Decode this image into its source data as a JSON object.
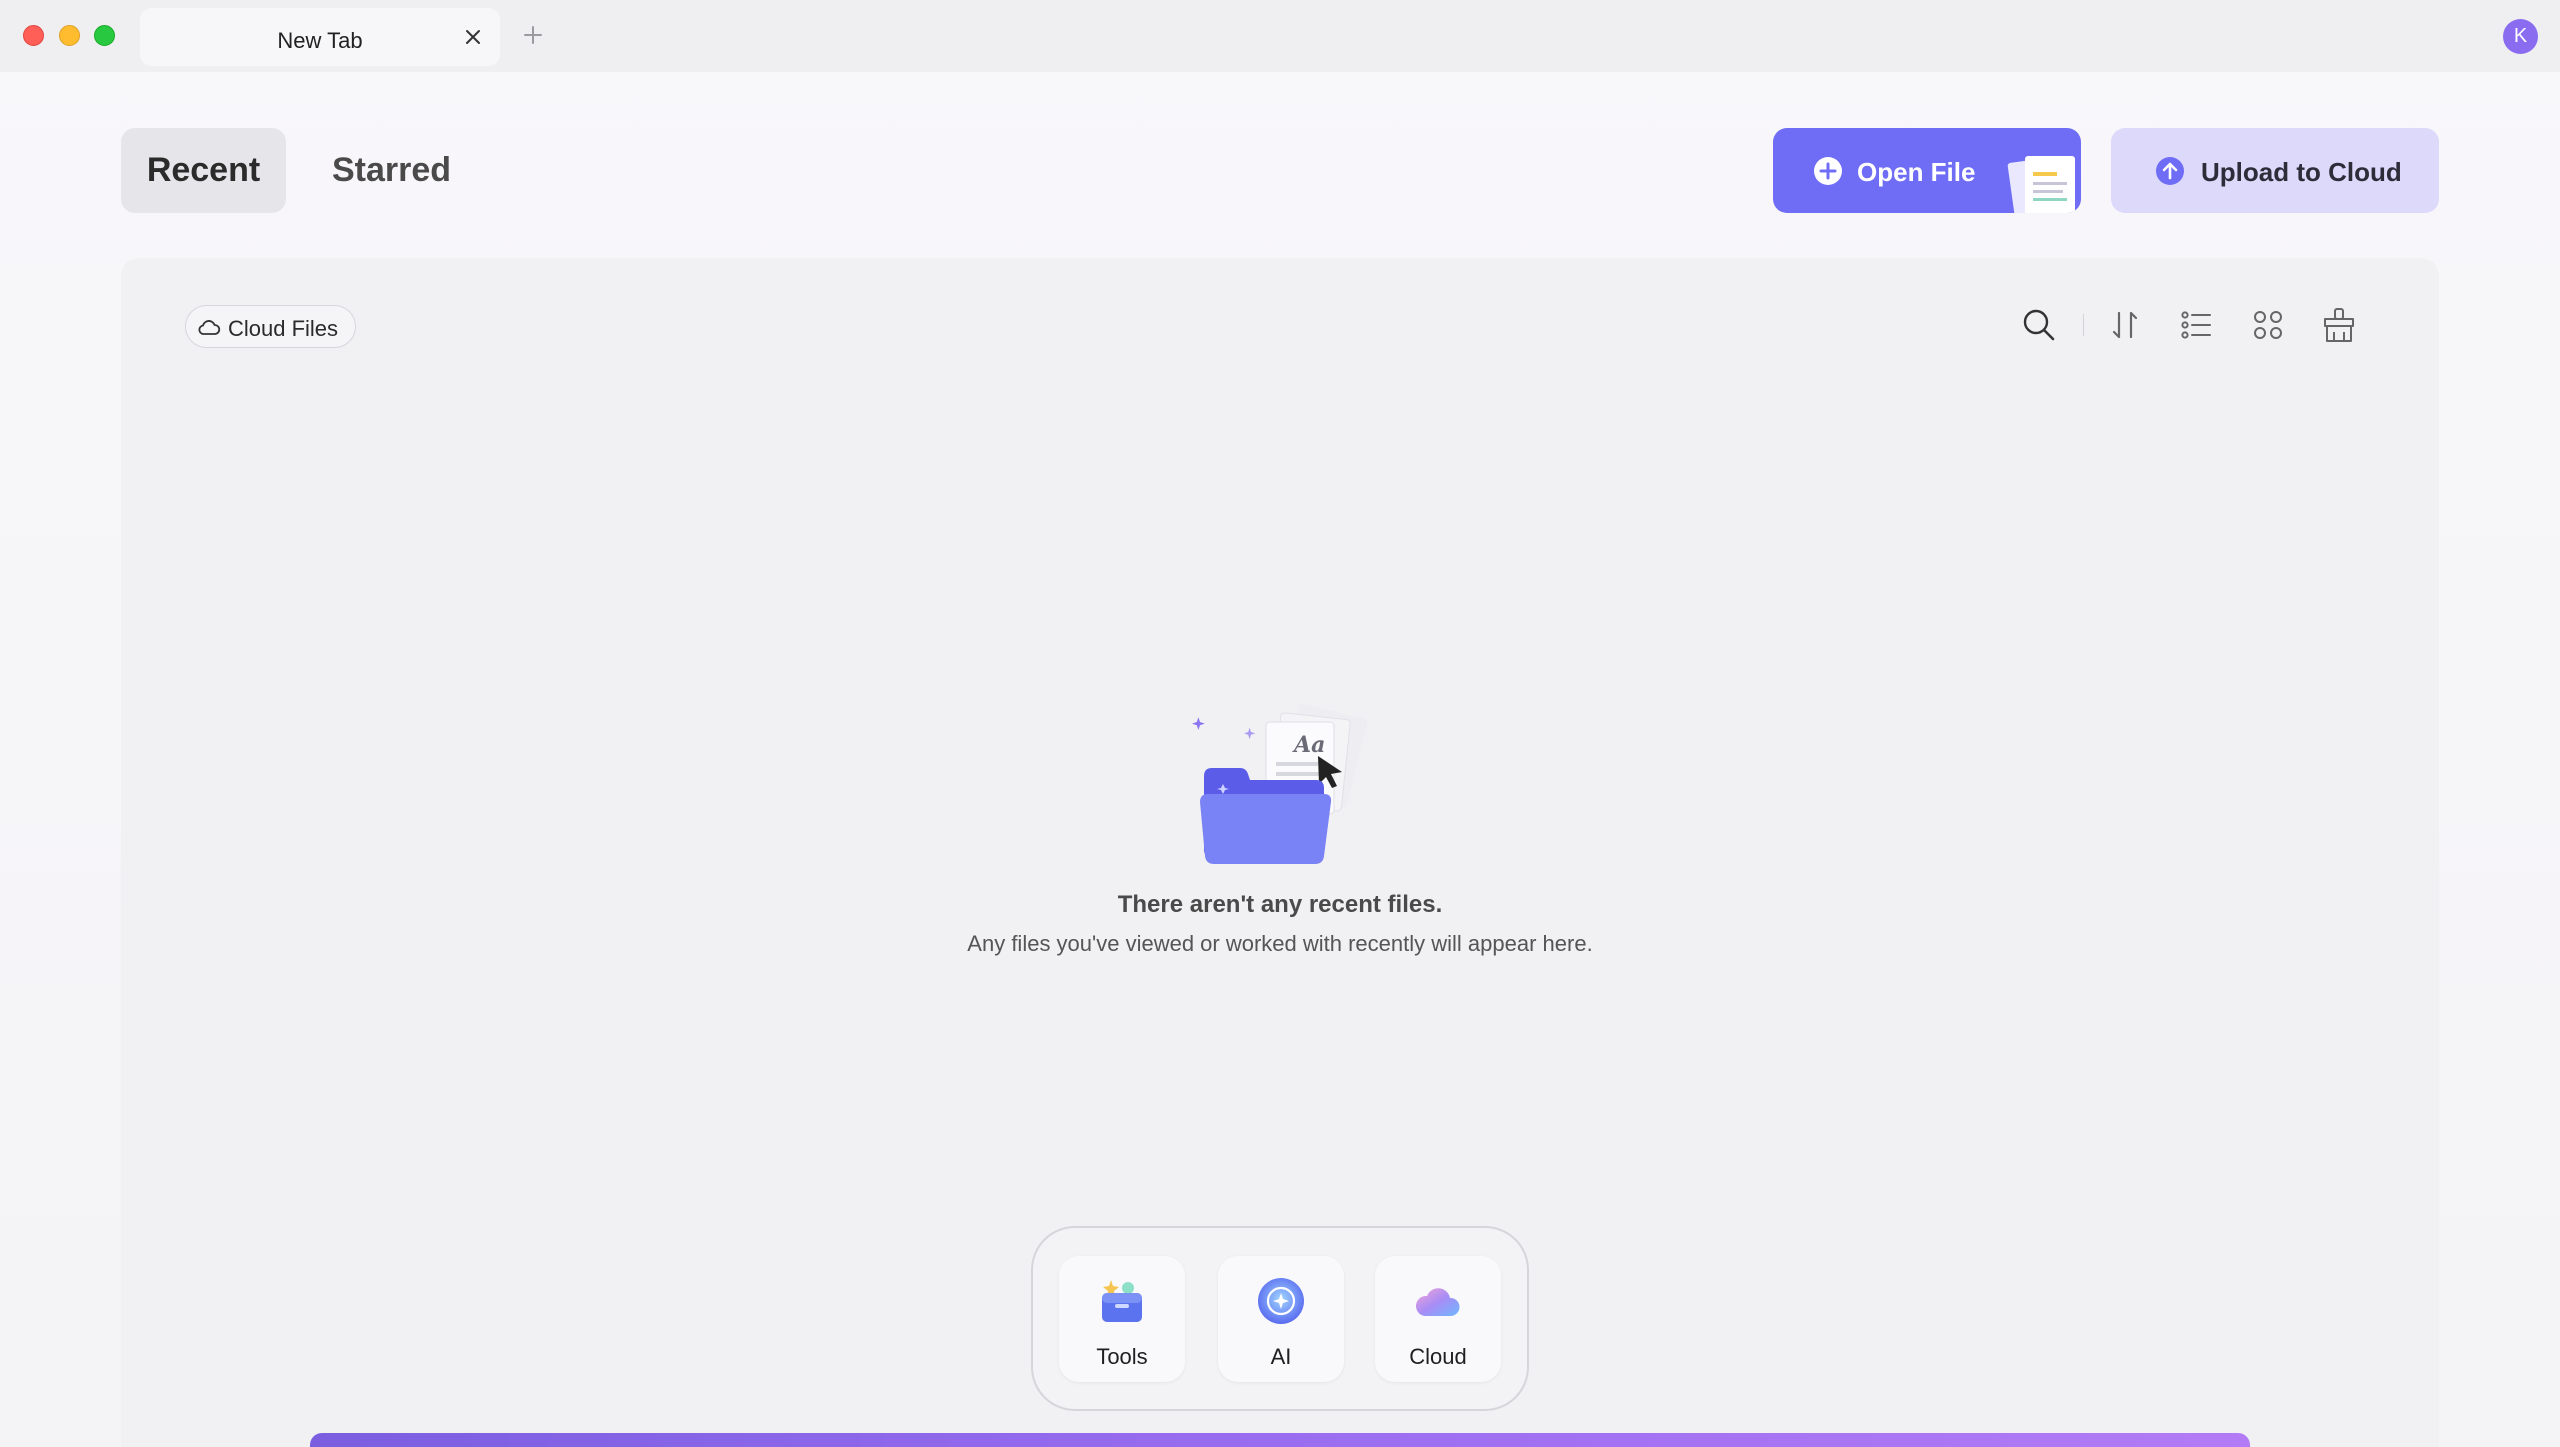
{
  "tab": {
    "title": "New Tab"
  },
  "user": {
    "avatar_initial": "K"
  },
  "nav": {
    "recent": "Recent",
    "starred": "Starred"
  },
  "actions": {
    "open_file": "Open File",
    "upload_to_cloud": "Upload to Cloud"
  },
  "toolbar": {
    "cloud_files": "Cloud Files",
    "icons": [
      "search-icon",
      "sort-icon",
      "list-view-icon",
      "grid-view-icon",
      "clear-icon"
    ]
  },
  "empty_state": {
    "title": "There aren't any recent files.",
    "subtitle": "Any files you've viewed or worked with recently will appear here."
  },
  "dock": {
    "tools": "Tools",
    "ai": "AI",
    "cloud": "Cloud"
  },
  "colors": {
    "accent": "#6f6cf6",
    "accent_soft": "#dcd9fb",
    "avatar": "#8a6cf0"
  }
}
